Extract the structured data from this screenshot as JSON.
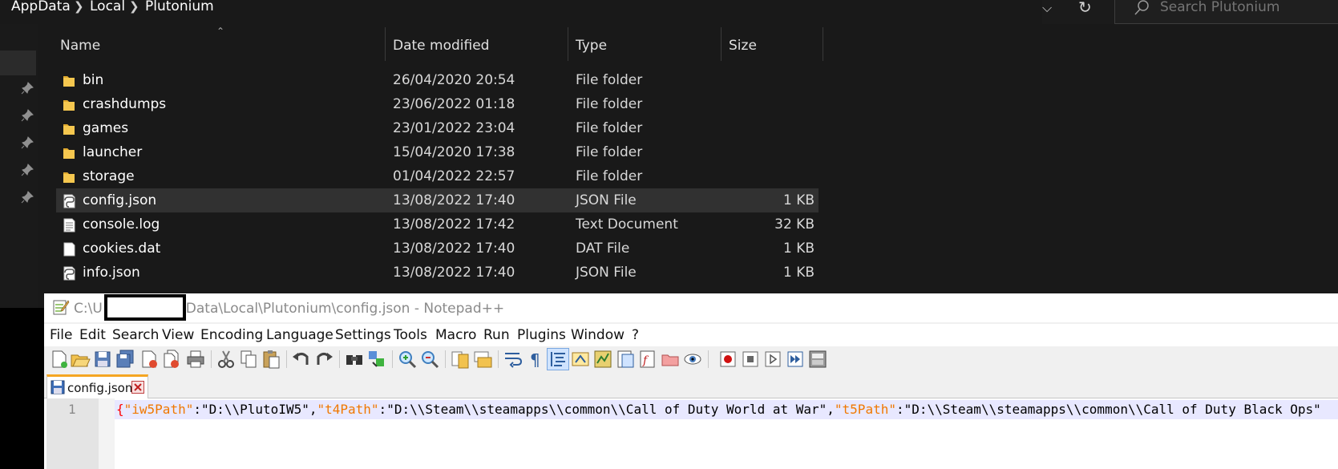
{
  "explorer": {
    "breadcrumb": [
      "AppData",
      "Local",
      "Plutonium"
    ],
    "search_placeholder": "Search Plutonium",
    "columns": {
      "name": "Name",
      "date": "Date modified",
      "type": "Type",
      "size": "Size"
    },
    "rows": [
      {
        "name": "bin",
        "date": "26/04/2020 20:54",
        "type": "File folder",
        "size": "",
        "icon": "folder-icon"
      },
      {
        "name": "crashdumps",
        "date": "23/06/2022 01:18",
        "type": "File folder",
        "size": "",
        "icon": "folder-icon"
      },
      {
        "name": "games",
        "date": "23/01/2022 23:04",
        "type": "File folder",
        "size": "",
        "icon": "folder-icon"
      },
      {
        "name": "launcher",
        "date": "15/04/2020 17:38",
        "type": "File folder",
        "size": "",
        "icon": "folder-icon"
      },
      {
        "name": "storage",
        "date": "01/04/2022 22:57",
        "type": "File folder",
        "size": "",
        "icon": "folder-icon"
      },
      {
        "name": "config.json",
        "date": "13/08/2022 17:40",
        "type": "JSON File",
        "size": "1 KB",
        "icon": "json-file-icon",
        "selected": true
      },
      {
        "name": "console.log",
        "date": "13/08/2022 17:42",
        "type": "Text Document",
        "size": "32 KB",
        "icon": "text-file-icon"
      },
      {
        "name": "cookies.dat",
        "date": "13/08/2022 17:40",
        "type": "DAT File",
        "size": "1 KB",
        "icon": "blank-file-icon"
      },
      {
        "name": "info.json",
        "date": "13/08/2022 17:40",
        "type": "JSON File",
        "size": "1 KB",
        "icon": "json-file-icon"
      }
    ]
  },
  "notepad": {
    "title_prefix": "C:\\U",
    "title_suffix": "Data\\Local\\Plutonium\\config.json - Notepad++",
    "menu": [
      "File",
      "Edit",
      "Search",
      "View",
      "Encoding",
      "Language",
      "Settings",
      "Tools",
      "Macro",
      "Run",
      "Plugins",
      "Window",
      "?"
    ],
    "tab_label": "config.json",
    "line_number": "1",
    "code": {
      "open": "{",
      "k1": "\"iw5Path\"",
      "c1": ":",
      "v1": "\"D:\\\\PlutoIW5\"",
      "s1": ",",
      "k2": "\"t4Path\"",
      "c2": ":",
      "v2": "\"D:\\\\Steam\\\\steamapps\\\\common\\\\Call of Duty World at War\"",
      "s2": ",",
      "k3": "\"t5Path\"",
      "c3": ":",
      "v3": "\"D:\\\\Steam\\\\steamapps\\\\common\\\\Call of Duty Black Ops\""
    }
  },
  "colors": {
    "explorer_bg": "#191919",
    "selected_row": "#313131",
    "folder": "#f5c74f",
    "npp_key": "#f07800",
    "npp_brace": "#ff0000",
    "npp_tab_accent": "#f5a623"
  }
}
